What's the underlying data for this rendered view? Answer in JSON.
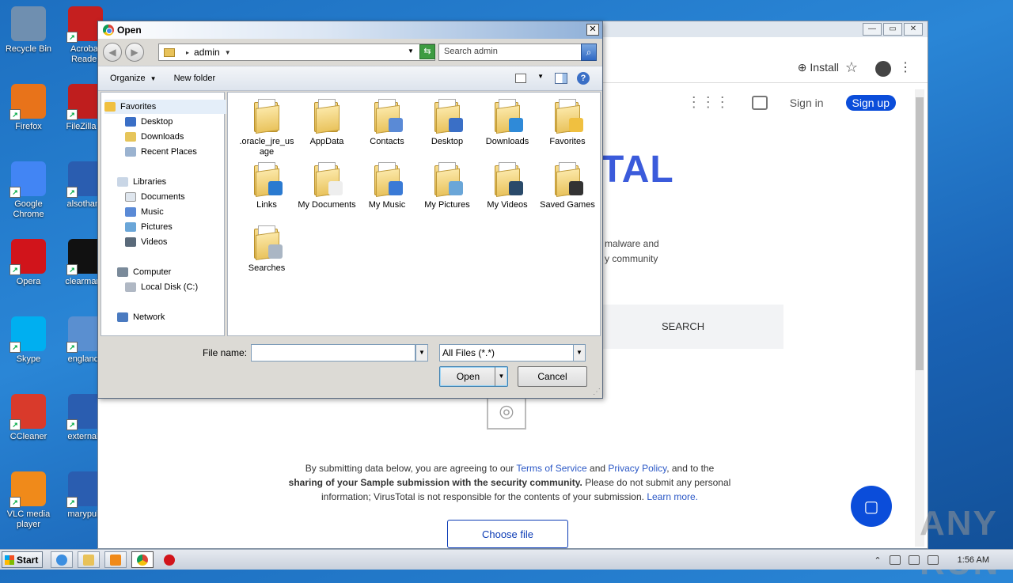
{
  "desktop": {
    "icons_col1": [
      "Recycle Bin",
      "Firefox",
      "Google Chrome",
      "Opera",
      "Skype",
      "CCleaner",
      "VLC media player"
    ],
    "icons_col2": [
      "Acrobat Reader",
      "FileZilla C",
      "alsothank",
      "clearmanu",
      "englands",
      "externala",
      "marypubl"
    ]
  },
  "browser": {
    "install_label": "Install",
    "signin_label": "Sign in",
    "signup_label": "Sign up",
    "logo_fragment": "TAL",
    "desc_line1": "malware and",
    "desc_line2": "y community",
    "search_tab_label": "SEARCH",
    "consent": {
      "p1": "By submitting data below, you are agreeing to our ",
      "tos": "Terms of Service",
      "and": " and ",
      "privacy": "Privacy Policy",
      "p2": ", and to the",
      "bold": "sharing of your Sample submission with the security community.",
      "p3": " Please do not submit any personal information; VirusTotal is not responsible for the contents of your submission. ",
      "learn": "Learn more."
    },
    "choose_file_label": "Choose file",
    "watermark": "ANY RUN"
  },
  "dialog": {
    "title": "Open",
    "path_root_sep": "▸",
    "path_item": "admin",
    "search_placeholder": "Search admin",
    "organize_label": "Organize",
    "new_folder_label": "New folder",
    "nav": {
      "favorites": "Favorites",
      "desktop": "Desktop",
      "downloads": "Downloads",
      "recent": "Recent Places",
      "libraries": "Libraries",
      "documents": "Documents",
      "music": "Music",
      "pictures": "Pictures",
      "videos": "Videos",
      "computer": "Computer",
      "local_disk": "Local Disk (C:)",
      "network": "Network"
    },
    "files": [
      {
        "name": ".oracle_jre_usage",
        "icon": "folder-plain"
      },
      {
        "name": "AppData",
        "icon": "folder-plain"
      },
      {
        "name": "Contacts",
        "icon": "folder-contacts"
      },
      {
        "name": "Desktop",
        "icon": "folder-desktop"
      },
      {
        "name": "Downloads",
        "icon": "folder-downloads"
      },
      {
        "name": "Favorites",
        "icon": "folder-favorites"
      },
      {
        "name": "Links",
        "icon": "folder-links"
      },
      {
        "name": "My Documents",
        "icon": "folder-documents"
      },
      {
        "name": "My Music",
        "icon": "folder-music"
      },
      {
        "name": "My Pictures",
        "icon": "folder-pictures"
      },
      {
        "name": "My Videos",
        "icon": "folder-videos"
      },
      {
        "name": "Saved Games",
        "icon": "folder-games"
      },
      {
        "name": "Searches",
        "icon": "folder-searches"
      }
    ],
    "filename_label": "File name:",
    "filename_value": "",
    "filetype_value": "All Files (*.*)",
    "open_label": "Open",
    "cancel_label": "Cancel"
  },
  "taskbar": {
    "start_label": "Start",
    "clock": "1:56 AM"
  }
}
